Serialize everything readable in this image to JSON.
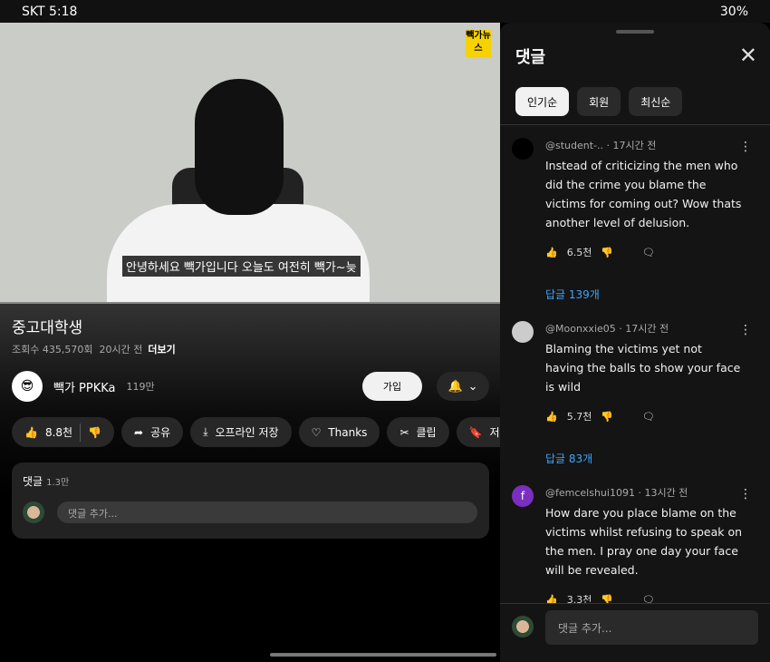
{
  "status": {
    "carrier_time": "SKT 5:18",
    "icons": "alarm-icon cloud-icon",
    "right": "30%"
  },
  "video": {
    "logo": "빽가뉴스",
    "subtitle": "안녕하세요 빽가입니다 오늘도 여전히 빽가~늦",
    "title": "중고대학생",
    "views": "조회수 435,570회",
    "age": "20시간 전",
    "more": "더보기"
  },
  "channel": {
    "name": "빽가 PPKKa",
    "subs": "119만",
    "join": "가입"
  },
  "actions": {
    "likes": "8.8천",
    "share": "공유",
    "download": "오프라인 저장",
    "thanks": "Thanks",
    "clip": "클립",
    "save": "저장"
  },
  "comments_card": {
    "label": "댓글",
    "count": "1.3만",
    "placeholder": "댓글 추가..."
  },
  "panel": {
    "title": "댓글",
    "tabs": [
      "인기순",
      "회원",
      "최신순"
    ],
    "placeholder": "댓글 추가...",
    "comments": [
      {
        "author": "@student-..",
        "time": "17시간 전",
        "text": "Instead of criticizing the men who did the crime you blame the victims for coming out? Wow thats another level of delusion.",
        "likes": "6.5천",
        "replies": "답글 139개",
        "avatar_color": "#000000"
      },
      {
        "author": "@Moonxxie05",
        "time": "17시간 전",
        "text": "Blaming the victims yet not having the balls to show your face is wild",
        "likes": "5.7천",
        "replies": "답글 83개",
        "avatar_color": "#cccccc"
      },
      {
        "author": "@femcelshui1091",
        "time": "13시간 전",
        "text": "How dare you place blame on the victims whilst refusing to speak on the men. I pray one day your face will be revealed.",
        "likes": "3.3천",
        "replies": "",
        "avatar_color": "#7b2fbe",
        "initial": "f"
      }
    ]
  }
}
